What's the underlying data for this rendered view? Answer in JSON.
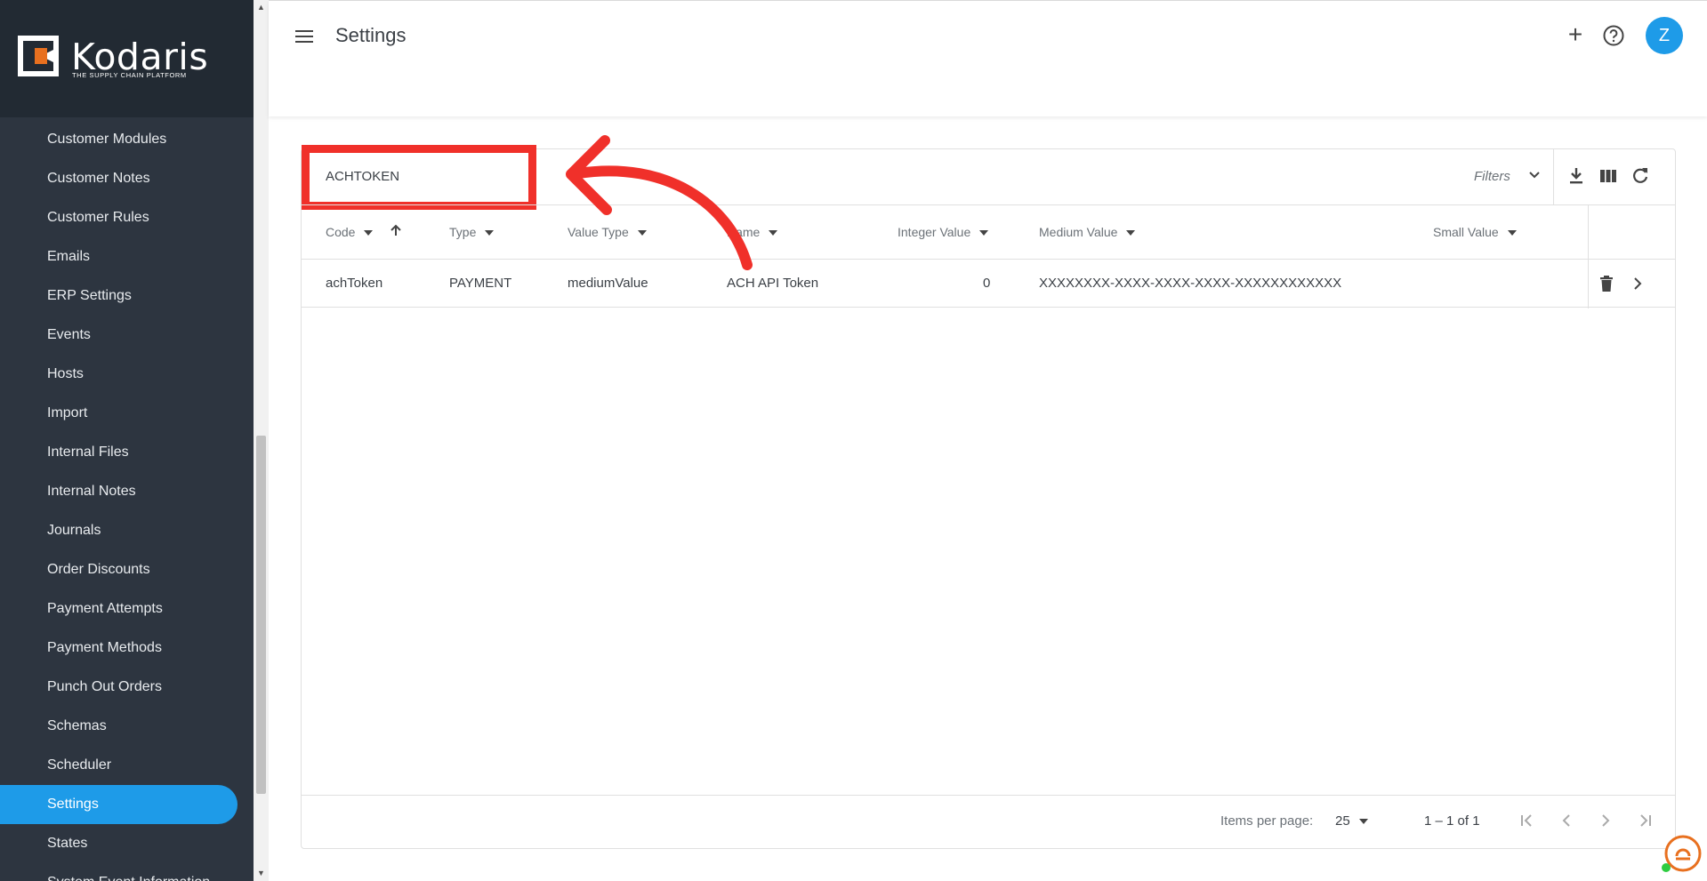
{
  "brand": {
    "name": "Kodaris",
    "tagline": "THE SUPPLY CHAIN PLATFORM"
  },
  "sidebar": {
    "items": [
      {
        "label": "Customer Modules"
      },
      {
        "label": "Customer Notes"
      },
      {
        "label": "Customer Rules"
      },
      {
        "label": "Emails"
      },
      {
        "label": "ERP Settings"
      },
      {
        "label": "Events"
      },
      {
        "label": "Hosts"
      },
      {
        "label": "Import"
      },
      {
        "label": "Internal Files"
      },
      {
        "label": "Internal Notes"
      },
      {
        "label": "Journals"
      },
      {
        "label": "Order Discounts"
      },
      {
        "label": "Payment Attempts"
      },
      {
        "label": "Payment Methods"
      },
      {
        "label": "Punch Out Orders"
      },
      {
        "label": "Schemas"
      },
      {
        "label": "Scheduler"
      },
      {
        "label": "Settings",
        "active": true
      },
      {
        "label": "States"
      },
      {
        "label": "System Event Information"
      }
    ]
  },
  "header": {
    "title": "Settings",
    "avatar_initial": "Z"
  },
  "toolbar": {
    "search_value": "ACHTOKEN",
    "filters_label": "Filters"
  },
  "table": {
    "columns": [
      {
        "label": "Code"
      },
      {
        "label": "Type"
      },
      {
        "label": "Value Type"
      },
      {
        "label": "Name"
      },
      {
        "label": "Integer Value"
      },
      {
        "label": "Medium Value"
      },
      {
        "label": "Small Value"
      }
    ],
    "rows": [
      {
        "code": "achToken",
        "type": "PAYMENT",
        "value_type": "mediumValue",
        "name": "ACH API Token",
        "integer_value": "0",
        "medium_value": "XXXXXXXX-XXXX-XXXX-XXXX-XXXXXXXXXXXX",
        "small_value": ""
      }
    ]
  },
  "pagination": {
    "items_per_page_label": "Items per page:",
    "page_size": "25",
    "range": "1 – 1 of 1"
  },
  "colors": {
    "sidebar_bg": "#2d3540",
    "accent": "#1e9be8",
    "annotation": "#f0302a",
    "brand_orange": "#e8701f"
  }
}
